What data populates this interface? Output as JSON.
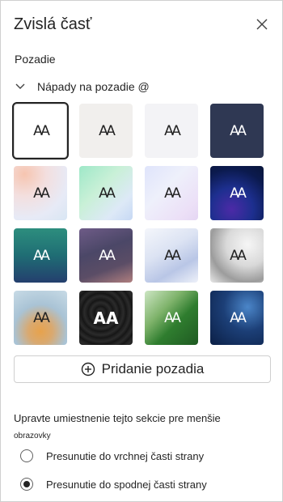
{
  "panel": {
    "title": "Zvislá časť",
    "close_icon": "close-icon"
  },
  "background": {
    "section_label": "Pozadie",
    "ideas_label": "Nápady na pozadie @",
    "tile_text": "AA",
    "tiles": [
      {
        "name": "white",
        "selected": true
      },
      {
        "name": "warm-gray"
      },
      {
        "name": "cool-gray"
      },
      {
        "name": "navy"
      },
      {
        "name": "peach-gradient"
      },
      {
        "name": "mint-gradient"
      },
      {
        "name": "lavender-gradient"
      },
      {
        "name": "deep-purple"
      },
      {
        "name": "teal-blue"
      },
      {
        "name": "mauve"
      },
      {
        "name": "silver-wave"
      },
      {
        "name": "gray-abstract"
      },
      {
        "name": "golden-bokeh"
      },
      {
        "name": "black-swirl"
      },
      {
        "name": "green-leaf"
      },
      {
        "name": "blue-network"
      }
    ],
    "add_button_label": "Pridanie pozadia",
    "add_icon": "plus-circle-icon"
  },
  "placement": {
    "description": "Upravte umiestnenie tejto sekcie pre menšie",
    "description_sub": "obrazovky",
    "options": [
      {
        "label": "Presunutie do vrchnej časti strany",
        "checked": false
      },
      {
        "label": "Presunutie do spodnej časti strany",
        "checked": true
      }
    ]
  }
}
